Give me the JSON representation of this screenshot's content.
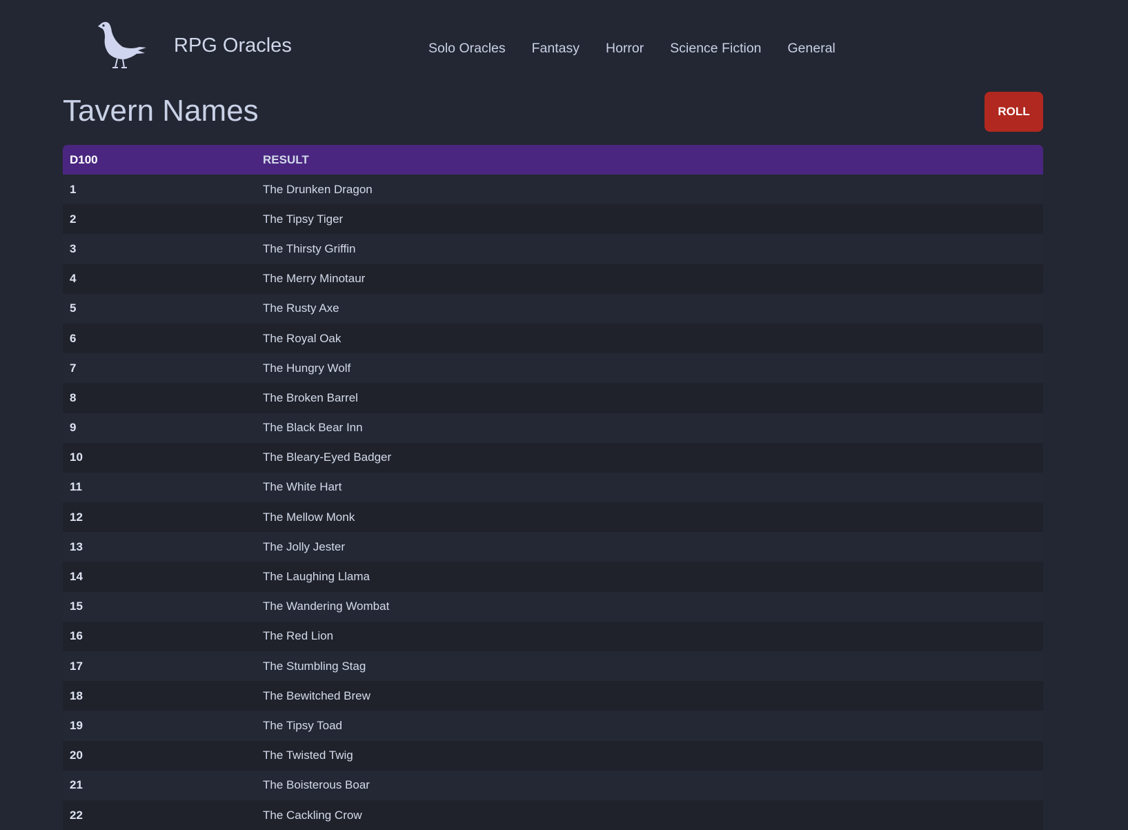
{
  "header": {
    "site_title": "RPG Oracles",
    "logo_icon": "raven-icon",
    "nav": [
      {
        "label": "Solo Oracles"
      },
      {
        "label": "Fantasy"
      },
      {
        "label": "Horror"
      },
      {
        "label": "Science Fiction"
      },
      {
        "label": "General"
      }
    ]
  },
  "page": {
    "title": "Tavern Names",
    "roll_label": "ROLL"
  },
  "table": {
    "columns": [
      "D100",
      "RESULT"
    ],
    "rows": [
      {
        "d": "1",
        "result": "The Drunken Dragon"
      },
      {
        "d": "2",
        "result": "The Tipsy Tiger"
      },
      {
        "d": "3",
        "result": "The Thirsty Griffin"
      },
      {
        "d": "4",
        "result": "The Merry Minotaur"
      },
      {
        "d": "5",
        "result": "The Rusty Axe"
      },
      {
        "d": "6",
        "result": "The Royal Oak"
      },
      {
        "d": "7",
        "result": "The Hungry Wolf"
      },
      {
        "d": "8",
        "result": "The Broken Barrel"
      },
      {
        "d": "9",
        "result": "The Black Bear Inn"
      },
      {
        "d": "10",
        "result": "The Bleary-Eyed Badger"
      },
      {
        "d": "11",
        "result": "The White Hart"
      },
      {
        "d": "12",
        "result": "The Mellow Monk"
      },
      {
        "d": "13",
        "result": "The Jolly Jester"
      },
      {
        "d": "14",
        "result": "The Laughing Llama"
      },
      {
        "d": "15",
        "result": "The Wandering Wombat"
      },
      {
        "d": "16",
        "result": "The Red Lion"
      },
      {
        "d": "17",
        "result": "The Stumbling Stag"
      },
      {
        "d": "18",
        "result": "The Bewitched Brew"
      },
      {
        "d": "19",
        "result": "The Tipsy Toad"
      },
      {
        "d": "20",
        "result": "The Twisted Twig"
      },
      {
        "d": "21",
        "result": "The Boisterous Boar"
      },
      {
        "d": "22",
        "result": "The Cackling Crow"
      }
    ]
  },
  "colors": {
    "background": "#232733",
    "header_row": "#4a2680",
    "roll_button": "#b0281f",
    "row_alt": "#1f222b"
  }
}
